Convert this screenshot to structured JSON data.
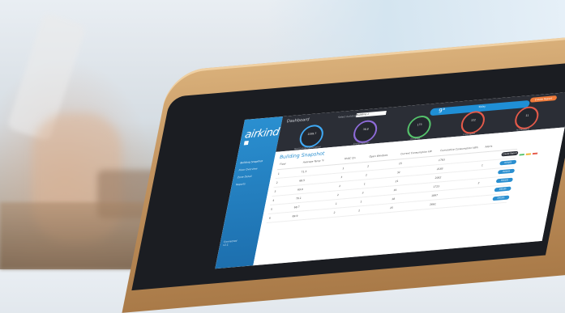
{
  "app": {
    "logo_text": "airkind",
    "nav_items": [
      "Building Snapshot",
      "Floor Overview",
      "Zone Detail",
      "Reports"
    ],
    "footer_lines": [
      "Connected",
      "v2.1"
    ]
  },
  "topbar": {
    "title": "Dashboard",
    "select_label": "Select building",
    "select_value": "Building 1",
    "weather_temp": "9°",
    "weather_sub": "Today",
    "report_button": "Create Report",
    "gauges": [
      {
        "value": "1599.7",
        "unit": "kWh",
        "label": "Total Energy Consumption",
        "color": "#3fa9f5"
      },
      {
        "value": "36.8",
        "unit": "kWh",
        "label": "Energy Savings",
        "color": "#8e6bd9"
      },
      {
        "value": "173",
        "unit": "Rooms",
        "label": "Occupied",
        "color": "#55c26b"
      },
      {
        "value": "122",
        "unit": "Rooms",
        "label": "Unoccupied",
        "color": "#e55a4a"
      },
      {
        "value": "11",
        "unit": "Alerts",
        "label": "Active Alerts",
        "color": "#e55a4a"
      }
    ]
  },
  "snapshot": {
    "title": "Building Snapshot",
    "columns": [
      "Floor",
      "Average Temp °F",
      "HVAC On",
      "Open Windows",
      "Current Consumption kW",
      "Cumulative Consumption kWh",
      "Alerts"
    ],
    "rows": [
      {
        "floor": "1",
        "temp": "71.3",
        "hvac": "1",
        "windows": "2",
        "current": "15",
        "cumulative": "1763",
        "alerts": "",
        "action": "Create Report",
        "action_style": "dark"
      },
      {
        "floor": "2",
        "temp": "68.5",
        "hvac": "3",
        "windows": "2",
        "current": "32",
        "cumulative": "2183",
        "alerts": "1",
        "action": "Details",
        "action_style": "blue"
      },
      {
        "floor": "3",
        "temp": "69.0",
        "hvac": "2",
        "windows": "1",
        "current": "21",
        "cumulative": "2052",
        "alerts": "",
        "action": "Details",
        "action_style": "blue"
      },
      {
        "floor": "4",
        "temp": "70.1",
        "hvac": "2",
        "windows": "3",
        "current": "19",
        "cumulative": "1723",
        "alerts": "2",
        "action": "Details",
        "action_style": "blue"
      },
      {
        "floor": "5",
        "temp": "68.7",
        "hvac": "1",
        "windows": "1",
        "current": "18",
        "cumulative": "1897",
        "alerts": "",
        "action": "Details",
        "action_style": "blue"
      },
      {
        "floor": "6",
        "temp": "69.9",
        "hvac": "2",
        "windows": "2",
        "current": "25",
        "cumulative": "2661",
        "alerts": "",
        "action": "Details",
        "action_style": "blue"
      }
    ]
  },
  "colors": {
    "brand": "#2a8fd0",
    "topbar": "#2b2e36",
    "accent": "#f07b3a",
    "wood": "#c39460"
  }
}
